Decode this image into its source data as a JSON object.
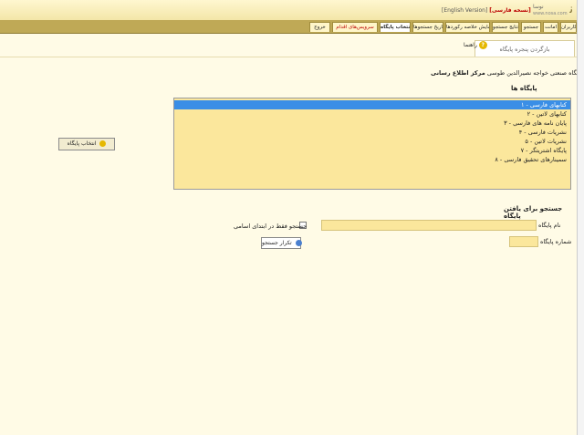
{
  "header": {
    "english_link": "[English Version]",
    "persian_label": "[نسخه فارسی]",
    "logo_name": "نوسا",
    "logo_url": "www.nosa.com"
  },
  "tabs": [
    {
      "label": "خروج"
    },
    {
      "label": "سرویس‌های اقدام"
    },
    {
      "label": "انتخاب پایگاه"
    },
    {
      "label": "تاریخ جستجوها"
    },
    {
      "label": "نمایش خلاصه رکوردها"
    },
    {
      "label": "نتایج جستجو"
    },
    {
      "label": "جستجو"
    },
    {
      "label": "امانت"
    },
    {
      "label": "کاربران"
    }
  ],
  "page_tab": "بازگردن پنجره پایگاه",
  "help_label": "راهنما",
  "center": {
    "label": "مرکز اطلاع رسانی",
    "value": "دانشگاه صنعتی خواجه نصیرالدین طوسی"
  },
  "databases": {
    "heading": "پایگاه ها",
    "items": [
      "۱ - کتابهای فارسی",
      "۲ - کتابهای لاتین",
      "۳ - پایان نامه های فارسی",
      "۴ - نشریات فارسی",
      "۵ - نشریات لاتین",
      "۷ - پایگاه اشتریتگر",
      "۸ - سمینارهای تحقیق فارسی"
    ],
    "select_button": "انتخاب پایگاه"
  },
  "search": {
    "heading": "جستجو برای یافتن پایگاه",
    "name_label": "نام پایگاه",
    "number_label": "شماره پایگاه",
    "prefix_option": "جستجو فقط در ابتدای اسامی",
    "repeat_button": "تکرار جستجو"
  },
  "colors": {
    "tab_bar": "#bfa956",
    "field_bg": "#fbe79c",
    "selected": "#3a8ee6",
    "accent_red": "#bb0000"
  }
}
